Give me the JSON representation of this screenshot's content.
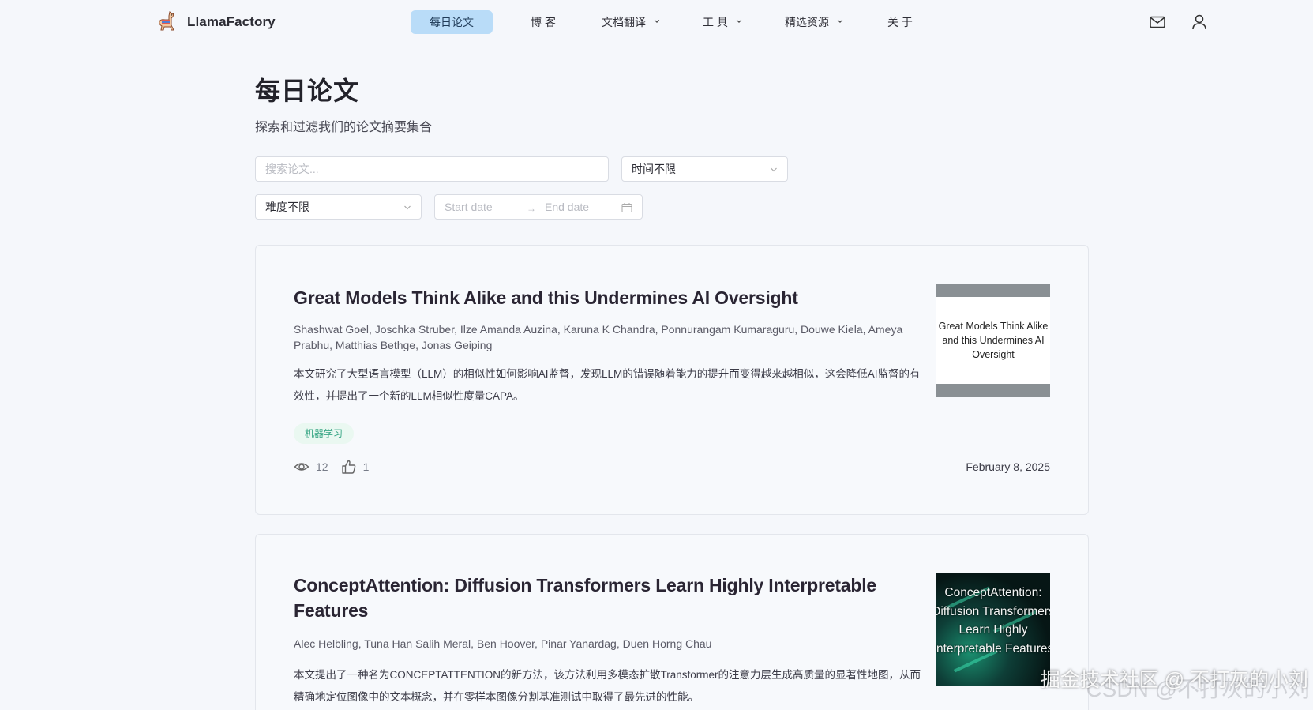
{
  "brand": {
    "name": "LlamaFactory"
  },
  "nav": {
    "items": [
      {
        "label": "每日论文",
        "active": true
      },
      {
        "label": "博 客"
      },
      {
        "label": "文档翻译",
        "dropdown": true
      },
      {
        "label": "工 具",
        "dropdown": true
      },
      {
        "label": "精选资源",
        "dropdown": true
      },
      {
        "label": "关 于"
      }
    ]
  },
  "header_icons": [
    "mail-icon",
    "user-icon"
  ],
  "page": {
    "title": "每日论文",
    "subtitle": "探索和过滤我们的论文摘要集合"
  },
  "filters": {
    "search_placeholder": "搜索论文...",
    "time_select": "时间不限",
    "difficulty_select": "难度不限",
    "start_date_placeholder": "Start date",
    "end_date_placeholder": "End date",
    "range_separator": "→"
  },
  "papers": [
    {
      "title": "Great Models Think Alike and this Undermines AI Oversight",
      "authors": "Shashwat Goel, Joschka Struber, Ilze Amanda Auzina, Karuna K Chandra, Ponnurangam Kumaraguru, Douwe Kiela, Ameya Prabhu, Matthias Bethge, Jonas Geiping",
      "summary": "本文研究了大型语言模型（LLM）的相似性如何影响AI监督，发现LLM的错误随着能力的提升而变得越来越相似，这会降低AI监督的有效性，并提出了一个新的LLM相似性度量CAPA。",
      "tag": "机器学习",
      "views": "12",
      "likes": "1",
      "date": "February 8, 2025",
      "thumbnail_text": "Great Models Think Alike and this Undermines AI Oversight"
    },
    {
      "title": "ConceptAttention: Diffusion Transformers Learn Highly Interpretable Features",
      "authors": "Alec Helbling, Tuna Han Salih Meral, Ben Hoover, Pinar Yanardag, Duen Horng Chau",
      "summary": "本文提出了一种名为CONCEPTATTENTION的新方法，该方法利用多模态扩散Transformer的注意力层生成高质量的显著性地图，从而精确地定位图像中的文本概念，并在零样本图像分割基准测试中取得了最先进的性能。",
      "thumbnail_text": "ConceptAttention: Diffusion Transformers Learn Highly Interpretable Features"
    }
  ],
  "watermark": "掘金技术社区 @ 不打灰的小刘",
  "watermark_faint": "CSDN @不打灰的小刘"
}
